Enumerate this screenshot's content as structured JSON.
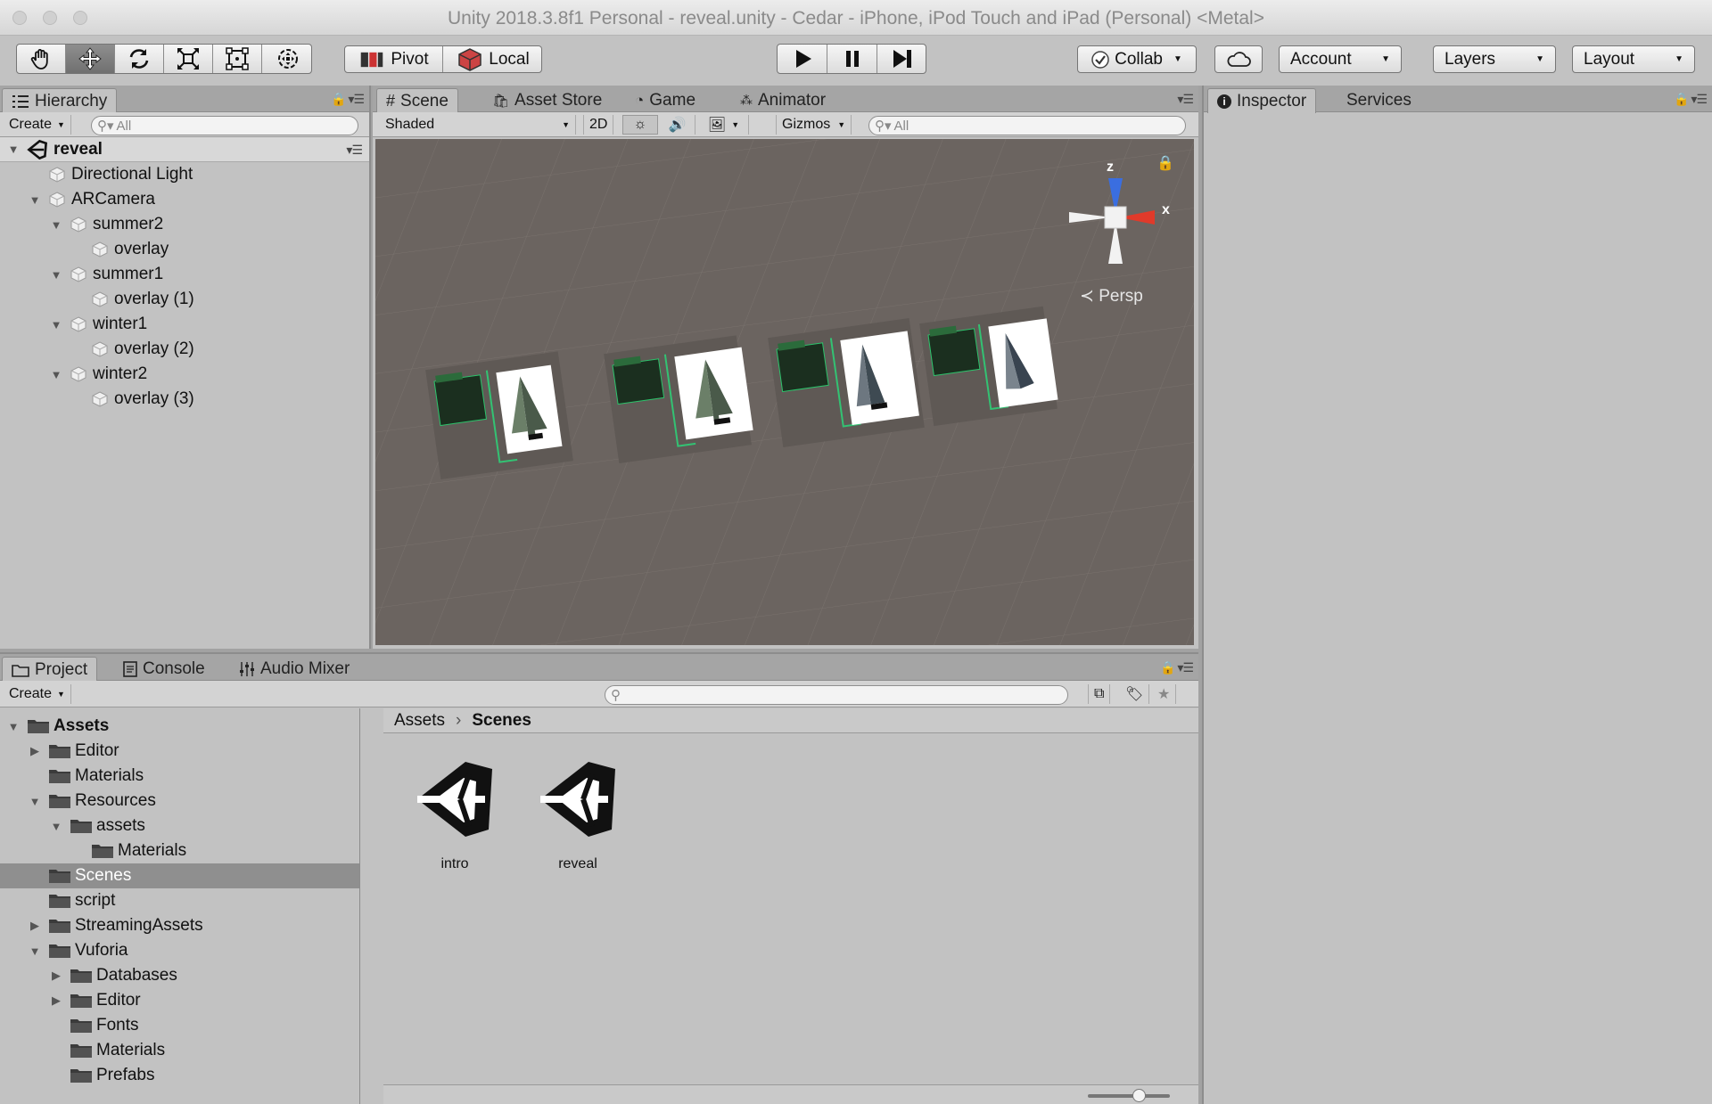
{
  "window": {
    "title": "Unity 2018.3.8f1 Personal - reveal.unity - Cedar - iPhone, iPod Touch and iPad (Personal) <Metal>"
  },
  "toolbar": {
    "transform_tools": [
      "hand-icon",
      "move-icon",
      "rotate-icon",
      "scale-icon",
      "rect-icon",
      "transform-icon"
    ],
    "pivot_label": "Pivot",
    "local_label": "Local",
    "collab_label": "Collab",
    "account_label": "Account",
    "layers_label": "Layers",
    "layout_label": "Layout"
  },
  "hierarchy": {
    "tab_label": "Hierarchy",
    "create_label": "Create",
    "search_placeholder": "All",
    "scene_name": "reveal",
    "items": [
      {
        "label": "Directional Light",
        "depth": 1,
        "fold": "none"
      },
      {
        "label": "ARCamera",
        "depth": 1,
        "fold": "open"
      },
      {
        "label": "summer2",
        "depth": 2,
        "fold": "open"
      },
      {
        "label": "overlay",
        "depth": 3,
        "fold": "none"
      },
      {
        "label": "summer1",
        "depth": 2,
        "fold": "open"
      },
      {
        "label": "overlay (1)",
        "depth": 3,
        "fold": "none"
      },
      {
        "label": "winter1",
        "depth": 2,
        "fold": "open"
      },
      {
        "label": "overlay (2)",
        "depth": 3,
        "fold": "none"
      },
      {
        "label": "winter2",
        "depth": 2,
        "fold": "open"
      },
      {
        "label": "overlay (3)",
        "depth": 3,
        "fold": "none"
      }
    ]
  },
  "scene_tabs": {
    "tabs": [
      {
        "label": "Scene",
        "icon": "grid-icon"
      },
      {
        "label": "Asset Store",
        "icon": "store-icon"
      },
      {
        "label": "Game",
        "icon": "pacman-icon"
      },
      {
        "label": "Animator",
        "icon": "animator-icon"
      }
    ],
    "shading_mode": "Shaded",
    "mode_2d": "2D",
    "gizmos_label": "Gizmos",
    "search_placeholder": "All",
    "gizmo_axes": {
      "z": "z",
      "x": "x"
    },
    "projection_label": "Persp"
  },
  "inspector": {
    "tabs": [
      "Inspector",
      "Services"
    ]
  },
  "project": {
    "tabs": [
      {
        "label": "Project",
        "icon": "folder-icon"
      },
      {
        "label": "Console",
        "icon": "console-icon"
      },
      {
        "label": "Audio Mixer",
        "icon": "mixer-icon"
      }
    ],
    "create_label": "Create",
    "tree": [
      {
        "label": "Assets",
        "depth": 0,
        "fold": "open",
        "bold": true
      },
      {
        "label": "Editor",
        "depth": 1,
        "fold": "closed"
      },
      {
        "label": "Materials",
        "depth": 1,
        "fold": "none"
      },
      {
        "label": "Resources",
        "depth": 1,
        "fold": "open"
      },
      {
        "label": "assets",
        "depth": 2,
        "fold": "open"
      },
      {
        "label": "Materials",
        "depth": 3,
        "fold": "none"
      },
      {
        "label": "Scenes",
        "depth": 1,
        "fold": "none",
        "selected": true
      },
      {
        "label": "script",
        "depth": 1,
        "fold": "none"
      },
      {
        "label": "StreamingAssets",
        "depth": 1,
        "fold": "closed"
      },
      {
        "label": "Vuforia",
        "depth": 1,
        "fold": "open"
      },
      {
        "label": "Databases",
        "depth": 2,
        "fold": "closed"
      },
      {
        "label": "Editor",
        "depth": 2,
        "fold": "closed"
      },
      {
        "label": "Fonts",
        "depth": 2,
        "fold": "none"
      },
      {
        "label": "Materials",
        "depth": 2,
        "fold": "none"
      },
      {
        "label": "Prefabs",
        "depth": 2,
        "fold": "none"
      }
    ],
    "breadcrumb": [
      "Assets",
      "Scenes"
    ],
    "files": [
      {
        "label": "intro",
        "icon": "unity-scene-icon"
      },
      {
        "label": "reveal",
        "icon": "unity-scene-icon"
      }
    ]
  }
}
